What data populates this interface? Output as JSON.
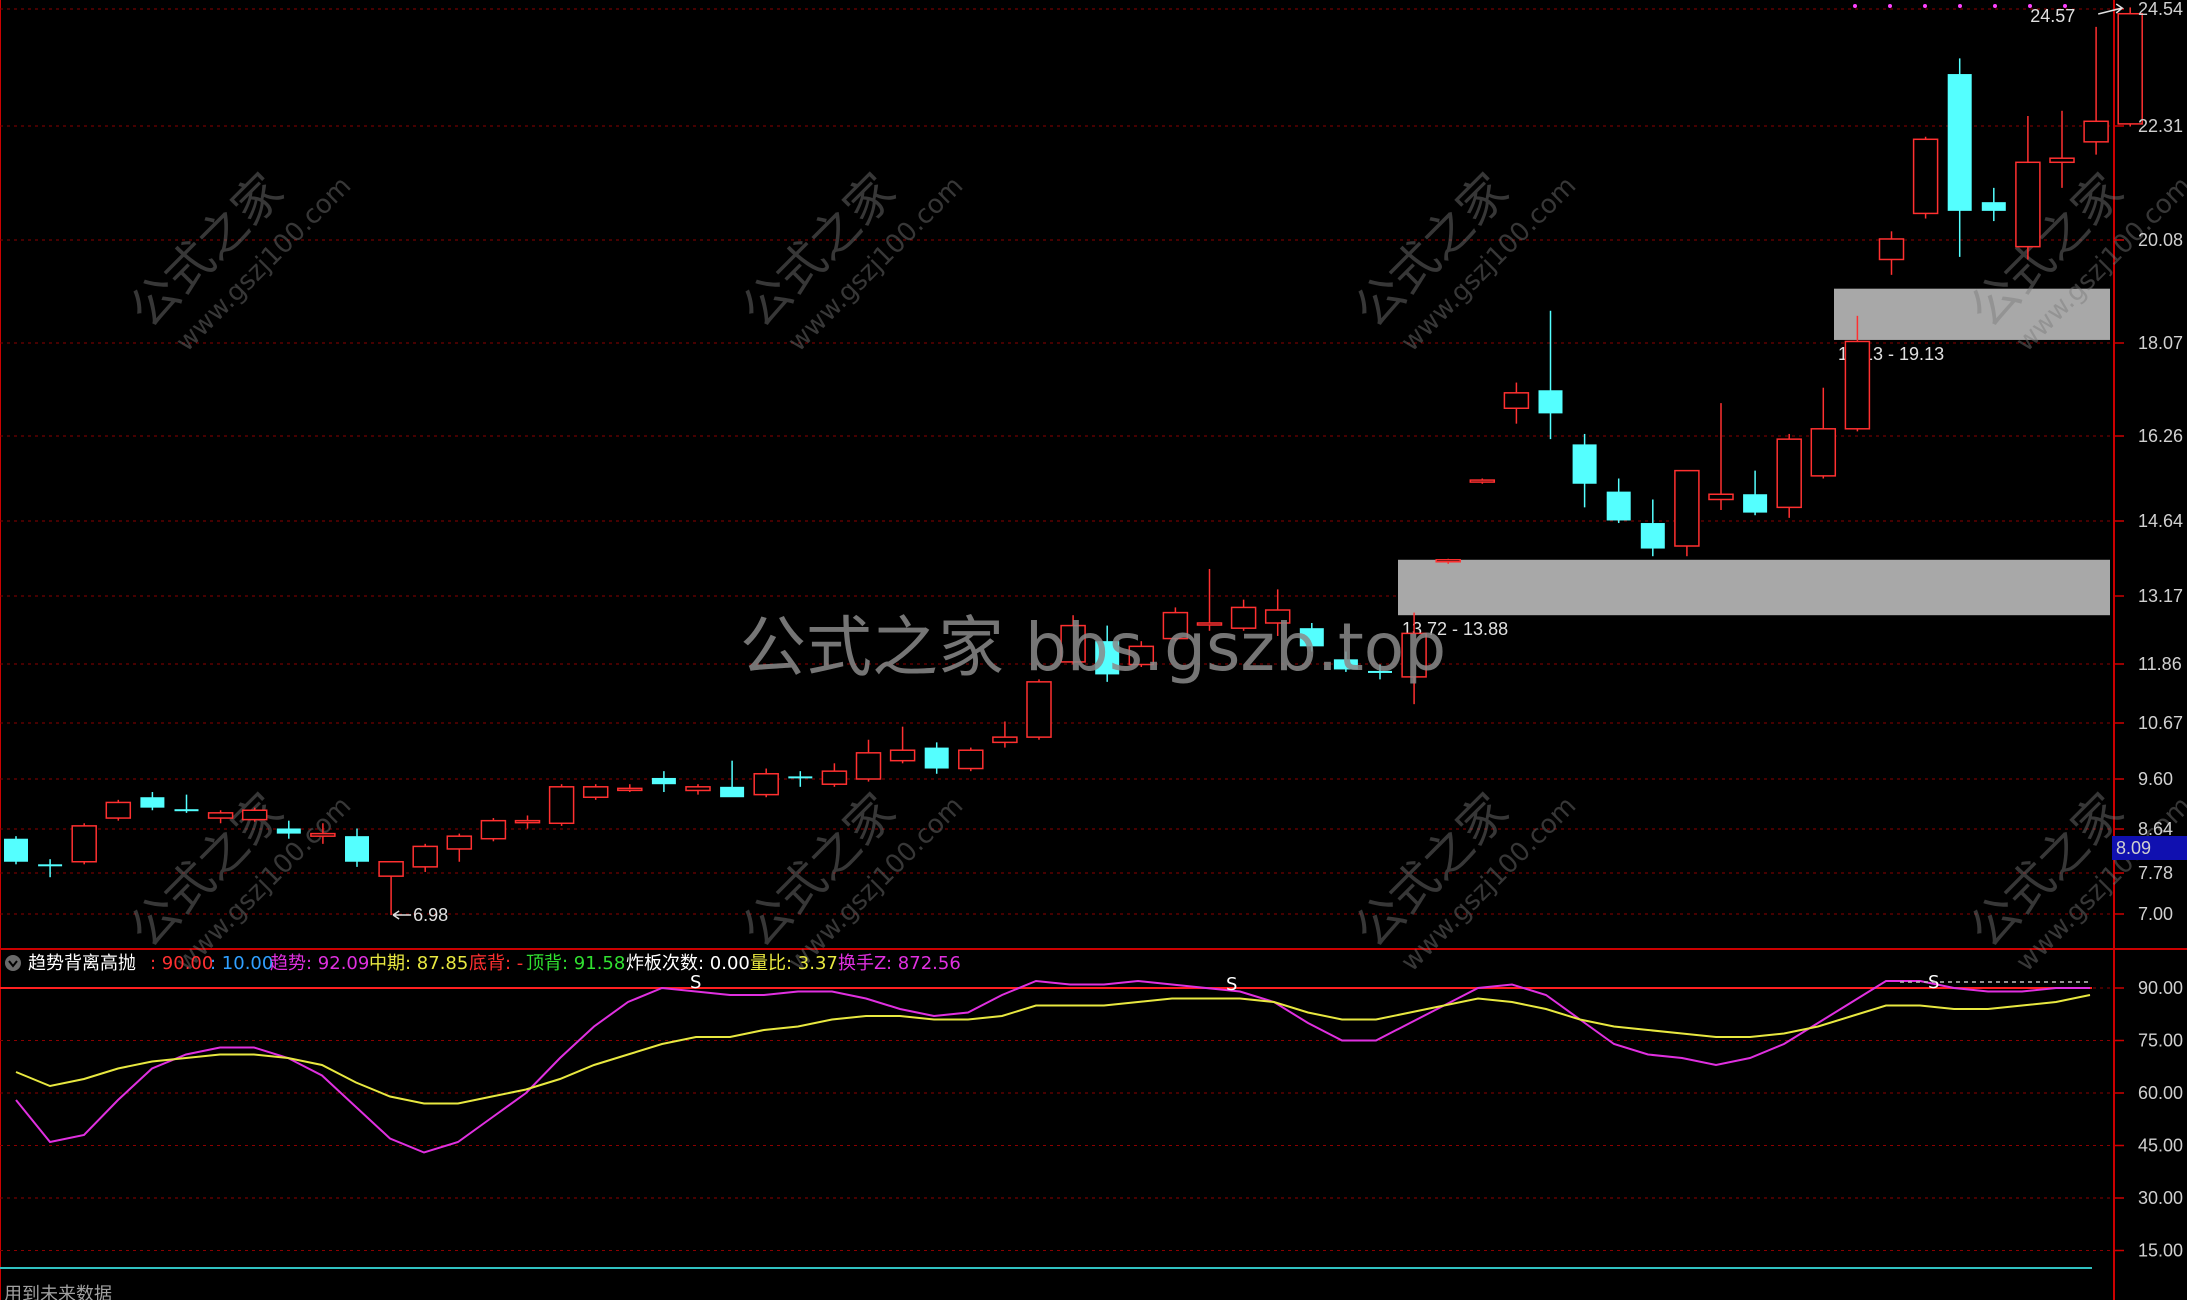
{
  "chart_data": [
    {
      "type": "candlestick",
      "y_ticks": [
        "24.54",
        "22.31",
        "20.08",
        "18.07",
        "16.26",
        "14.64",
        "13.17",
        "11.86",
        "10.67",
        "9.60",
        "8.64",
        "7.78",
        "7.00"
      ],
      "price_tag": "8.09",
      "low_marker": "6.98",
      "high_marker": "24.57",
      "zones": [
        {
          "label": "13.72 - 13.88",
          "low": 12.8,
          "high": 13.88
        },
        {
          "label": "18.13 - 19.13",
          "low": 18.13,
          "high": 19.13
        }
      ],
      "candles": [
        {
          "o": 8.45,
          "h": 8.5,
          "l": 7.95,
          "c": 8.0
        },
        {
          "o": 7.95,
          "h": 8.05,
          "l": 7.7,
          "c": 7.92
        },
        {
          "o": 8.0,
          "h": 8.75,
          "l": 7.95,
          "c": 8.7
        },
        {
          "o": 8.85,
          "h": 9.2,
          "l": 8.8,
          "c": 9.15
        },
        {
          "o": 9.25,
          "h": 9.35,
          "l": 9.0,
          "c": 9.05
        },
        {
          "o": 9.02,
          "h": 9.3,
          "l": 8.95,
          "c": 9.0
        },
        {
          "o": 8.85,
          "h": 9.0,
          "l": 8.75,
          "c": 8.95
        },
        {
          "o": 8.82,
          "h": 9.05,
          "l": 8.78,
          "c": 9.0
        },
        {
          "o": 8.65,
          "h": 8.8,
          "l": 8.45,
          "c": 8.55
        },
        {
          "o": 8.5,
          "h": 8.75,
          "l": 8.35,
          "c": 8.55
        },
        {
          "o": 8.5,
          "h": 8.65,
          "l": 7.9,
          "c": 8.0
        },
        {
          "o": 7.72,
          "h": 8.0,
          "l": 6.98,
          "c": 8.0
        },
        {
          "o": 7.9,
          "h": 8.35,
          "l": 7.8,
          "c": 8.3
        },
        {
          "o": 8.25,
          "h": 8.55,
          "l": 8.0,
          "c": 8.5
        },
        {
          "o": 8.45,
          "h": 8.85,
          "l": 8.4,
          "c": 8.8
        },
        {
          "o": 8.78,
          "h": 8.9,
          "l": 8.65,
          "c": 8.8
        },
        {
          "o": 8.75,
          "h": 9.5,
          "l": 8.7,
          "c": 9.45
        },
        {
          "o": 9.25,
          "h": 9.5,
          "l": 9.2,
          "c": 9.45
        },
        {
          "o": 9.4,
          "h": 9.5,
          "l": 9.35,
          "c": 9.42
        },
        {
          "o": 9.62,
          "h": 9.75,
          "l": 9.35,
          "c": 9.5
        },
        {
          "o": 9.38,
          "h": 9.5,
          "l": 9.3,
          "c": 9.45
        },
        {
          "o": 9.45,
          "h": 9.95,
          "l": 9.3,
          "c": 9.25
        },
        {
          "o": 9.3,
          "h": 9.8,
          "l": 9.25,
          "c": 9.7
        },
        {
          "o": 9.65,
          "h": 9.75,
          "l": 9.45,
          "c": 9.62
        },
        {
          "o": 9.5,
          "h": 9.9,
          "l": 9.45,
          "c": 9.75
        },
        {
          "o": 9.6,
          "h": 10.35,
          "l": 9.55,
          "c": 10.1
        },
        {
          "o": 9.95,
          "h": 10.6,
          "l": 9.9,
          "c": 10.15
        },
        {
          "o": 10.2,
          "h": 10.3,
          "l": 9.7,
          "c": 9.8
        },
        {
          "o": 9.8,
          "h": 10.2,
          "l": 9.75,
          "c": 10.15
        },
        {
          "o": 10.3,
          "h": 10.7,
          "l": 10.2,
          "c": 10.4
        },
        {
          "o": 10.4,
          "h": 11.55,
          "l": 10.35,
          "c": 11.5
        },
        {
          "o": 11.9,
          "h": 12.8,
          "l": 11.85,
          "c": 12.6
        },
        {
          "o": 12.3,
          "h": 12.6,
          "l": 11.5,
          "c": 11.65
        },
        {
          "o": 11.85,
          "h": 12.3,
          "l": 11.8,
          "c": 12.2
        },
        {
          "o": 12.35,
          "h": 12.95,
          "l": 12.3,
          "c": 12.85
        },
        {
          "o": 12.65,
          "h": 13.7,
          "l": 12.5,
          "c": 12.65
        },
        {
          "o": 12.55,
          "h": 13.1,
          "l": 12.5,
          "c": 12.95
        },
        {
          "o": 12.65,
          "h": 13.3,
          "l": 12.4,
          "c": 12.9
        },
        {
          "o": 12.55,
          "h": 12.65,
          "l": 12.1,
          "c": 12.2
        },
        {
          "o": 11.95,
          "h": 12.1,
          "l": 11.7,
          "c": 11.75
        },
        {
          "o": 11.72,
          "h": 11.85,
          "l": 11.55,
          "c": 11.68
        },
        {
          "o": 11.6,
          "h": 12.85,
          "l": 11.05,
          "c": 12.45
        },
        {
          "o": 13.85,
          "h": 13.9,
          "l": 13.8,
          "c": 13.88
        },
        {
          "o": 15.4,
          "h": 15.45,
          "l": 15.35,
          "c": 15.42
        },
        {
          "o": 16.8,
          "h": 17.3,
          "l": 16.5,
          "c": 17.1
        },
        {
          "o": 17.15,
          "h": 18.7,
          "l": 16.2,
          "c": 16.7
        },
        {
          "o": 16.1,
          "h": 16.3,
          "l": 14.9,
          "c": 15.35
        },
        {
          "o": 15.2,
          "h": 15.45,
          "l": 14.6,
          "c": 14.65
        },
        {
          "o": 14.6,
          "h": 15.05,
          "l": 13.95,
          "c": 14.1
        },
        {
          "o": 14.15,
          "h": 15.6,
          "l": 13.95,
          "c": 15.6
        },
        {
          "o": 15.05,
          "h": 16.9,
          "l": 14.85,
          "c": 15.15
        },
        {
          "o": 15.15,
          "h": 15.6,
          "l": 14.75,
          "c": 14.8
        },
        {
          "o": 14.9,
          "h": 16.3,
          "l": 14.7,
          "c": 16.2
        },
        {
          "o": 15.5,
          "h": 17.2,
          "l": 15.45,
          "c": 16.4
        },
        {
          "o": 16.4,
          "h": 18.6,
          "l": 16.35,
          "c": 18.1
        },
        {
          "o": 19.7,
          "h": 20.25,
          "l": 19.4,
          "c": 20.1
        },
        {
          "o": 20.6,
          "h": 22.1,
          "l": 20.5,
          "c": 22.05
        },
        {
          "o": 23.3,
          "h": 23.6,
          "l": 19.75,
          "c": 20.65
        },
        {
          "o": 20.82,
          "h": 21.1,
          "l": 20.45,
          "c": 20.65
        },
        {
          "o": 19.95,
          "h": 22.5,
          "l": 19.7,
          "c": 21.6
        },
        {
          "o": 21.6,
          "h": 22.6,
          "l": 21.1,
          "c": 21.68
        },
        {
          "o": 22.0,
          "h": 24.2,
          "l": 21.75,
          "c": 22.4
        },
        {
          "o": 22.35,
          "h": 24.57,
          "l": 22.3,
          "c": 24.45
        }
      ]
    },
    {
      "type": "line",
      "y_ticks": [
        "90.00",
        "75.00",
        "60.00",
        "45.00",
        "30.00",
        "15.00"
      ],
      "ref_lines": [
        90,
        10
      ],
      "series": [
        {
          "name": "趋势",
          "color": "#e030e0",
          "values": [
            58,
            46,
            48,
            58,
            67,
            71,
            73,
            73,
            70,
            65,
            56,
            47,
            43,
            46,
            53,
            60,
            70,
            79,
            86,
            90,
            89,
            88,
            88,
            89,
            89,
            87,
            84,
            82,
            83,
            88,
            92,
            91,
            91,
            92,
            91,
            90,
            89,
            86,
            80,
            75,
            75,
            80,
            85,
            90,
            91,
            88,
            81,
            74,
            71,
            70,
            68,
            70,
            74,
            80,
            86,
            92,
            92,
            90,
            89,
            89,
            90,
            90
          ]
        },
        {
          "name": "中期",
          "color": "#e8e840",
          "values": [
            66,
            62,
            64,
            67,
            69,
            70,
            71,
            71,
            70,
            68,
            63,
            59,
            57,
            57,
            59,
            61,
            64,
            68,
            71,
            74,
            76,
            76,
            78,
            79,
            81,
            82,
            82,
            81,
            81,
            82,
            85,
            85,
            85,
            86,
            87,
            87,
            87,
            86,
            83,
            81,
            81,
            83,
            85,
            87,
            86,
            84,
            81,
            79,
            78,
            77,
            76,
            76,
            77,
            79,
            82,
            85,
            85,
            84,
            84,
            85,
            86,
            88
          ]
        }
      ]
    }
  ],
  "indicator": {
    "name": "趋势背离高抛",
    "v1": ": 90.00",
    "v2": ": 10.00",
    "trend_label": "趋势",
    "trend_value": ": 92.09",
    "mid_label": "中期",
    "mid_value": ": 87.85",
    "bottom_label": "底背",
    "bottom_value": ": -",
    "top_label": "顶背",
    "top_value": ": 91.58",
    "board_label": "炸板次数",
    "board_value": ": 0.00",
    "vol_label": "量比",
    "vol_value": ": 3.37",
    "turn_label": "换手Z",
    "turn_value": ": 872.56",
    "signal": "S"
  },
  "watermarks": {
    "brand": "公式之家",
    "site": "www.gszj100.com",
    "big": "公式之家 bbs.gszb.top"
  },
  "footer_text": "用到未来数据",
  "colors": {
    "up": "#ff3030",
    "down": "#54ffff",
    "grid": "#8b0000",
    "axis": "#cc0000",
    "zone": "#a8a8a8",
    "price_tag_bg": "#1010b0"
  }
}
